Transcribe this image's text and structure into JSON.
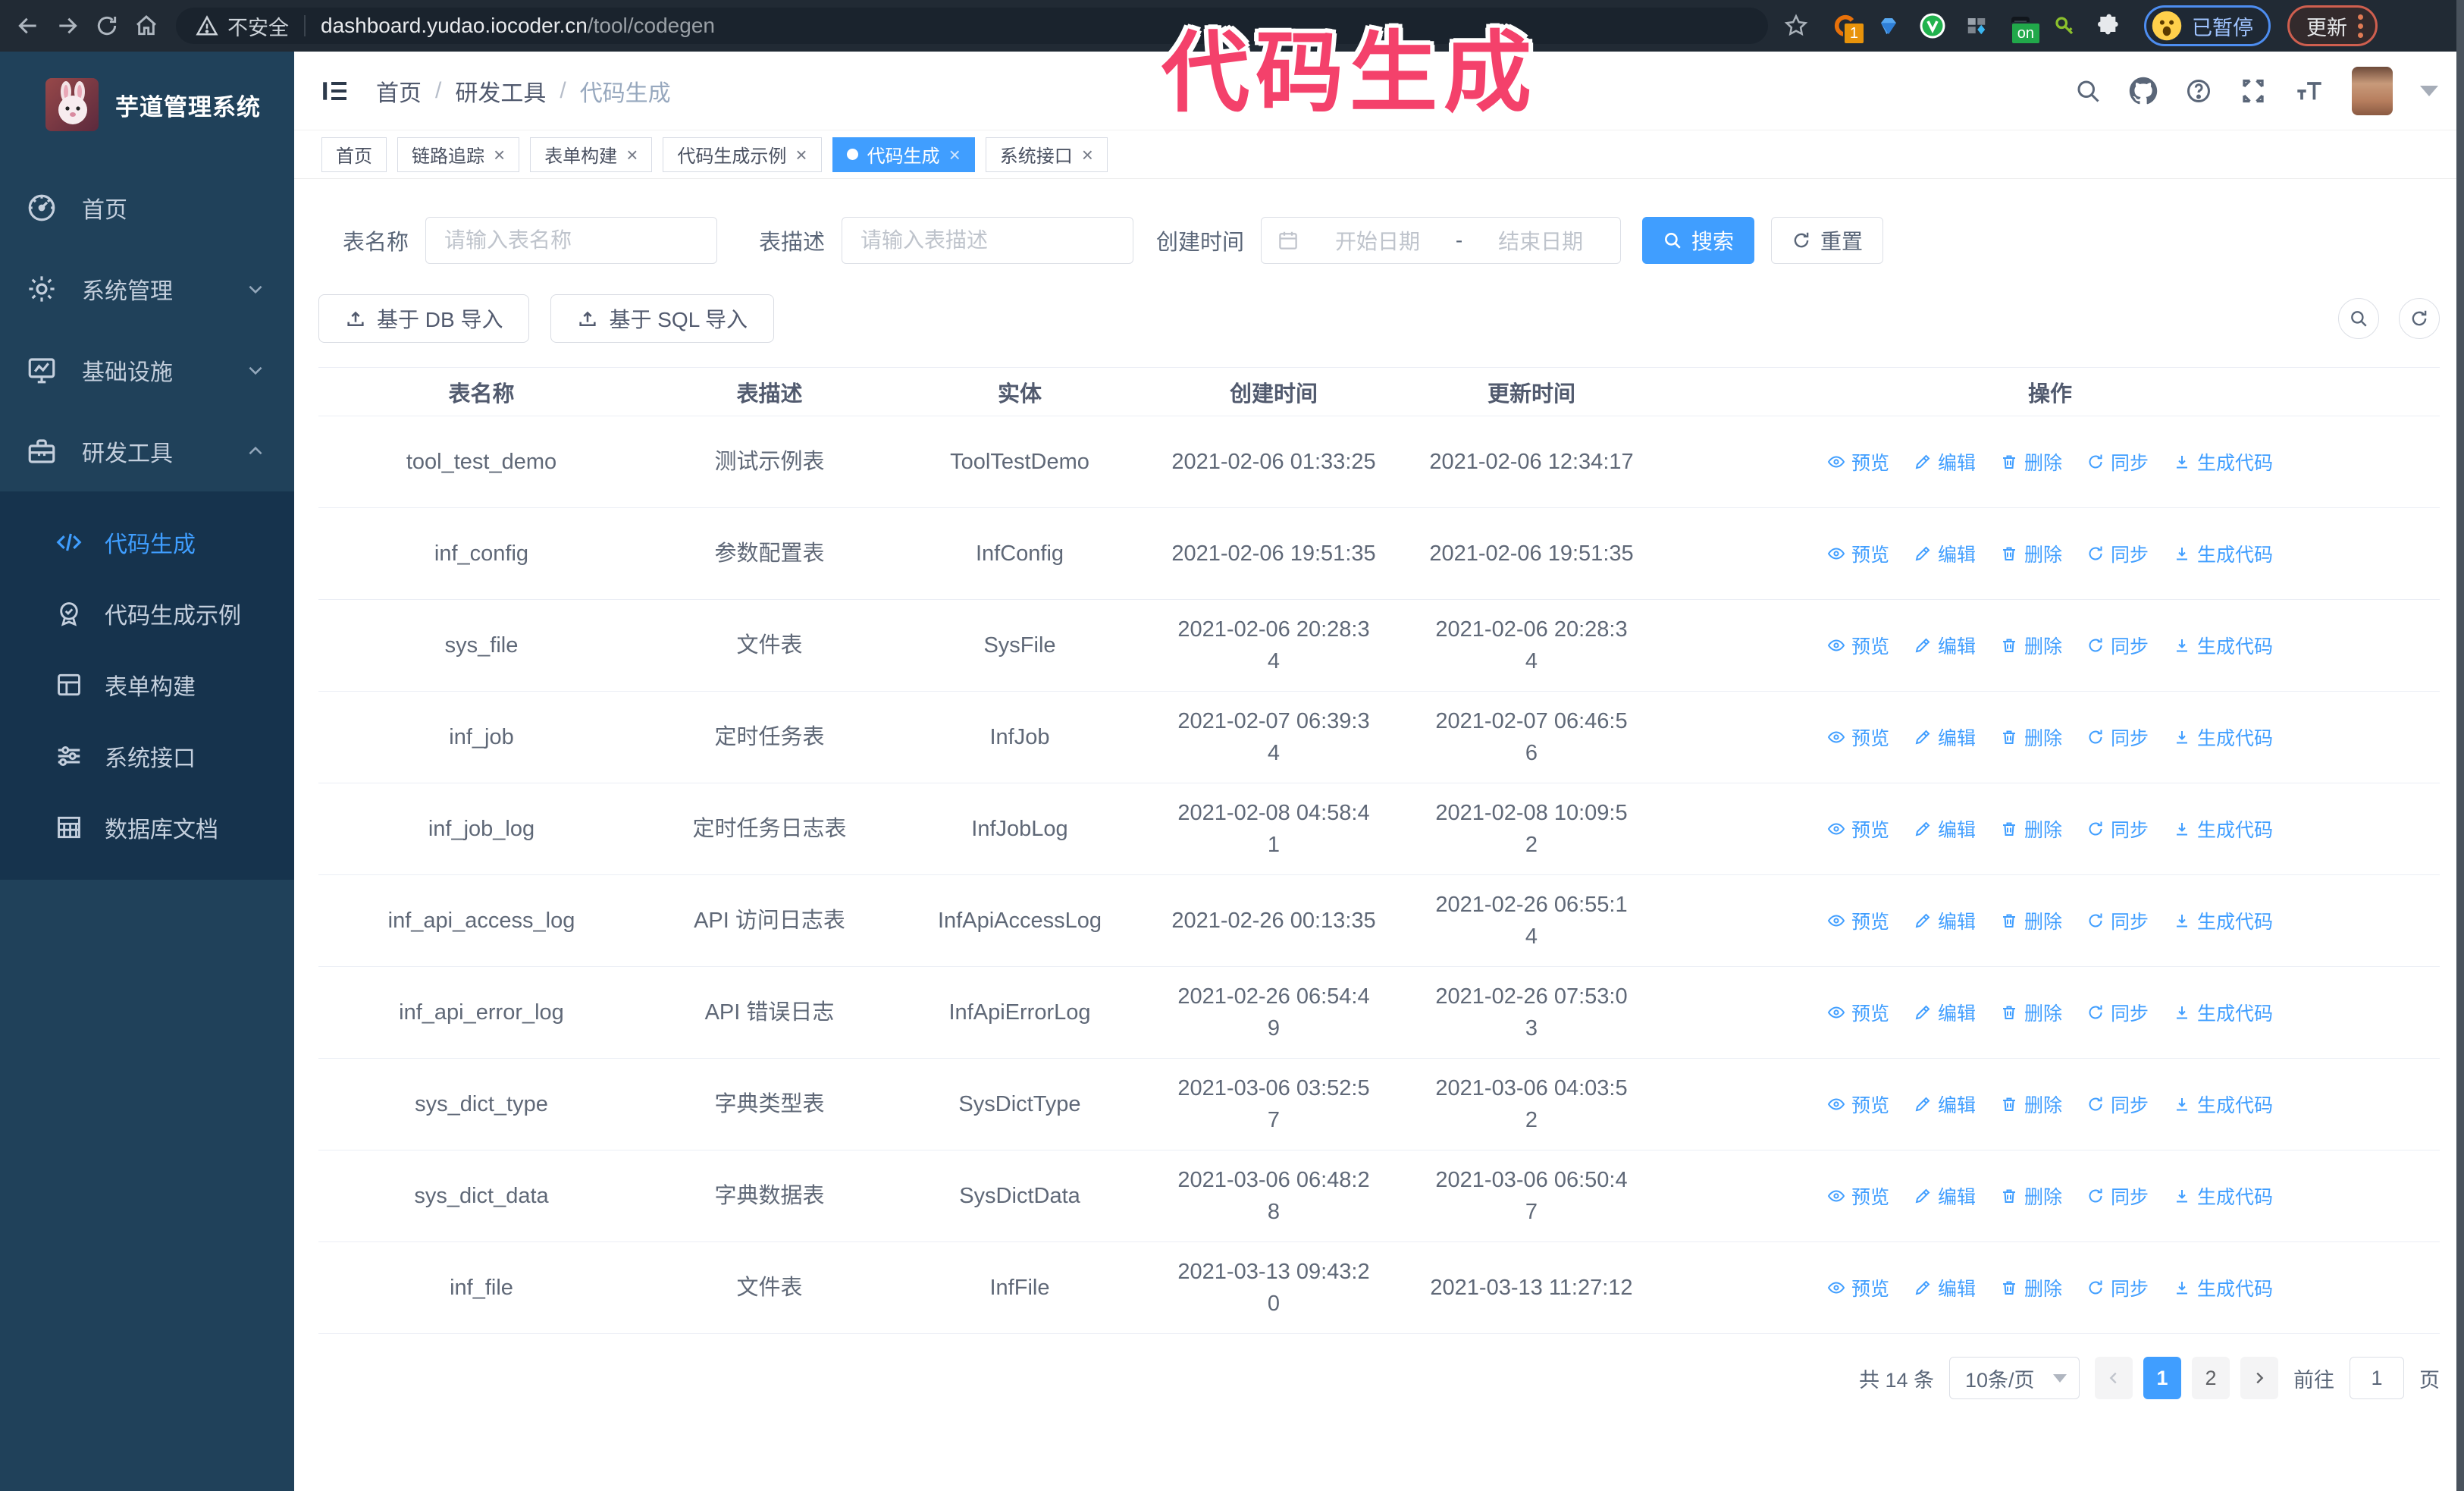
{
  "colors": {
    "accent": "#409eff",
    "annotation_pink": "#f4416b",
    "sidebar_bg": "#20415a",
    "submenu_bg": "#16334d",
    "chrome_bg": "#212a34"
  },
  "annotation": {
    "text": "代码生成"
  },
  "browser": {
    "security_label": "不安全",
    "url_host": "dashboard.yudao.iocoder.cn",
    "url_path": "/tool/codegen",
    "ext_badge_count": "1",
    "ext_badge_on": "on",
    "paused_badge": "已暂停",
    "update_button": "更新"
  },
  "sidebar": {
    "title": "芋道管理系统",
    "items": [
      {
        "label": "首页"
      },
      {
        "label": "系统管理"
      },
      {
        "label": "基础设施"
      },
      {
        "label": "研发工具"
      }
    ],
    "subitems": [
      {
        "label": "代码生成",
        "active": true
      },
      {
        "label": "代码生成示例",
        "active": false
      },
      {
        "label": "表单构建",
        "active": false
      },
      {
        "label": "系统接口",
        "active": false
      },
      {
        "label": "数据库文档",
        "active": false
      }
    ]
  },
  "breadcrumb": {
    "items": [
      "首页",
      "研发工具",
      "代码生成"
    ]
  },
  "tags": [
    {
      "label": "首页",
      "closable": false,
      "active": false
    },
    {
      "label": "链路追踪",
      "closable": true,
      "active": false
    },
    {
      "label": "表单构建",
      "closable": true,
      "active": false
    },
    {
      "label": "代码生成示例",
      "closable": true,
      "active": false
    },
    {
      "label": "代码生成",
      "closable": true,
      "active": true
    },
    {
      "label": "系统接口",
      "closable": true,
      "active": false
    }
  ],
  "search": {
    "name_label": "表名称",
    "name_placeholder": "请输入表名称",
    "desc_label": "表描述",
    "desc_placeholder": "请输入表描述",
    "time_label": "创建时间",
    "start_placeholder": "开始日期",
    "range_separator": "-",
    "end_placeholder": "结束日期",
    "search_button": "搜索",
    "reset_button": "重置"
  },
  "toolbar": {
    "import_db": "基于 DB 导入",
    "import_sql": "基于 SQL 导入"
  },
  "table": {
    "columns": [
      "表名称",
      "表描述",
      "实体",
      "创建时间",
      "更新时间",
      "操作"
    ],
    "actions": [
      {
        "label": "预览",
        "icon": "eye"
      },
      {
        "label": "编辑",
        "icon": "edit"
      },
      {
        "label": "删除",
        "icon": "delete"
      },
      {
        "label": "同步",
        "icon": "sync"
      },
      {
        "label": "生成代码",
        "icon": "download"
      }
    ],
    "rows": [
      {
        "name": "tool_test_demo",
        "desc": "测试示例表",
        "entity": "ToolTestDemo",
        "created": "2021-02-06 01:33:25",
        "updated": "2021-02-06 12:34:17"
      },
      {
        "name": "inf_config",
        "desc": "参数配置表",
        "entity": "InfConfig",
        "created": "2021-02-06 19:51:35",
        "updated": "2021-02-06 19:51:35"
      },
      {
        "name": "sys_file",
        "desc": "文件表",
        "entity": "SysFile",
        "created": [
          "2021-02-06 20:28:3",
          "4"
        ],
        "updated": [
          "2021-02-06 20:28:3",
          "4"
        ]
      },
      {
        "name": "inf_job",
        "desc": "定时任务表",
        "entity": "InfJob",
        "created": [
          "2021-02-07 06:39:3",
          "4"
        ],
        "updated": [
          "2021-02-07 06:46:5",
          "6"
        ]
      },
      {
        "name": "inf_job_log",
        "desc": "定时任务日志表",
        "entity": "InfJobLog",
        "created": [
          "2021-02-08 04:58:4",
          "1"
        ],
        "updated": [
          "2021-02-08 10:09:5",
          "2"
        ]
      },
      {
        "name": "inf_api_access_log",
        "desc": "API 访问日志表",
        "entity": "InfApiAccessLog",
        "created": "2021-02-26 00:13:35",
        "updated": [
          "2021-02-26 06:55:1",
          "4"
        ]
      },
      {
        "name": "inf_api_error_log",
        "desc": "API 错误日志",
        "entity": "InfApiErrorLog",
        "created": [
          "2021-02-26 06:54:4",
          "9"
        ],
        "updated": [
          "2021-02-26 07:53:0",
          "3"
        ]
      },
      {
        "name": "sys_dict_type",
        "desc": "字典类型表",
        "entity": "SysDictType",
        "created": [
          "2021-03-06 03:52:5",
          "7"
        ],
        "updated": [
          "2021-03-06 04:03:5",
          "2"
        ]
      },
      {
        "name": "sys_dict_data",
        "desc": "字典数据表",
        "entity": "SysDictData",
        "created": [
          "2021-03-06 06:48:2",
          "8"
        ],
        "updated": [
          "2021-03-06 06:50:4",
          "7"
        ]
      },
      {
        "name": "inf_file",
        "desc": "文件表",
        "entity": "InfFile",
        "created": [
          "2021-03-13 09:43:2",
          "0"
        ],
        "updated": "2021-03-13 11:27:12"
      }
    ]
  },
  "pagination": {
    "total": "共 14 条",
    "page_size": "10条/页",
    "pages": [
      "1",
      "2"
    ],
    "active_page": "1",
    "goto_label": "前往",
    "goto_value": "1",
    "page_unit": "页"
  }
}
